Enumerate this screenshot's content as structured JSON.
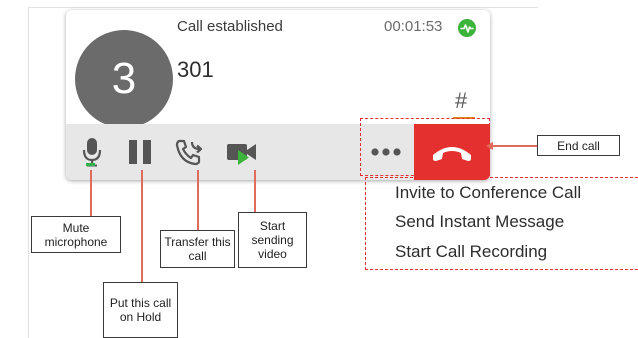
{
  "call": {
    "status": "Call established",
    "timer": "00:01:53",
    "avatar_letter": "3",
    "number": "301",
    "dialpad_symbol": "#"
  },
  "menu": {
    "items": [
      "Invite to Conference Call",
      "Send Instant Message",
      "Start Call Recording"
    ]
  },
  "annotations": {
    "end_call": "End call",
    "mute": "Mute microphone",
    "hold": "Put this call on Hold",
    "transfer": "Transfer this call",
    "video": "Start sending video"
  },
  "icons": {
    "activity": "activity-icon",
    "mute": "microphone-icon",
    "hold": "pause-icon",
    "transfer": "phone-transfer-icon",
    "video": "video-camera-icon",
    "more": "more-dots-icon",
    "end": "phone-hangup-icon"
  },
  "colors": {
    "end_call_red": "#e53030",
    "annotation_line": "#e06b5a",
    "activity_green": "#3cb43c",
    "hash_underline": "#e08a1e",
    "avatar_gray": "#6b6b6b"
  }
}
